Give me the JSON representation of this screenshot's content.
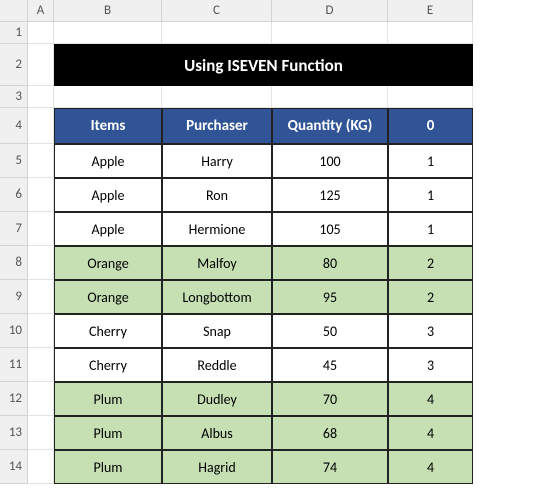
{
  "columns": [
    "A",
    "B",
    "C",
    "D",
    "E"
  ],
  "rows": [
    "1",
    "2",
    "3",
    "4",
    "5",
    "6",
    "7",
    "8",
    "9",
    "10",
    "11",
    "12",
    "13",
    "14"
  ],
  "title": "Using ISEVEN Function",
  "headers": {
    "items": "Items",
    "purchaser": "Purchaser",
    "quantity": "Quantity (KG)",
    "group": "0"
  },
  "data": [
    {
      "item": "Apple",
      "purchaser": "Harry",
      "qty": "100",
      "grp": "1",
      "alt": false
    },
    {
      "item": "Apple",
      "purchaser": "Ron",
      "qty": "125",
      "grp": "1",
      "alt": false
    },
    {
      "item": "Apple",
      "purchaser": "Hermione",
      "qty": "105",
      "grp": "1",
      "alt": false
    },
    {
      "item": "Orange",
      "purchaser": "Malfoy",
      "qty": "80",
      "grp": "2",
      "alt": true
    },
    {
      "item": "Orange",
      "purchaser": "Longbottom",
      "qty": "95",
      "grp": "2",
      "alt": true
    },
    {
      "item": "Cherry",
      "purchaser": "Snap",
      "qty": "50",
      "grp": "3",
      "alt": false
    },
    {
      "item": "Cherry",
      "purchaser": "Reddle",
      "qty": "45",
      "grp": "3",
      "alt": false
    },
    {
      "item": "Plum",
      "purchaser": "Dudley",
      "qty": "70",
      "grp": "4",
      "alt": true
    },
    {
      "item": "Plum",
      "purchaser": "Albus",
      "qty": "68",
      "grp": "4",
      "alt": true
    },
    {
      "item": "Plum",
      "purchaser": "Hagrid",
      "qty": "74",
      "grp": "4",
      "alt": true
    }
  ],
  "chart_data": {
    "type": "table",
    "title": "Using ISEVEN Function",
    "columns": [
      "Items",
      "Purchaser",
      "Quantity (KG)",
      "0"
    ],
    "rows": [
      [
        "Apple",
        "Harry",
        100,
        1
      ],
      [
        "Apple",
        "Ron",
        125,
        1
      ],
      [
        "Apple",
        "Hermione",
        105,
        1
      ],
      [
        "Orange",
        "Malfoy",
        80,
        2
      ],
      [
        "Orange",
        "Longbottom",
        95,
        2
      ],
      [
        "Cherry",
        "Snap",
        50,
        3
      ],
      [
        "Cherry",
        "Reddle",
        45,
        3
      ],
      [
        "Plum",
        "Dudley",
        70,
        4
      ],
      [
        "Plum",
        "Albus",
        68,
        4
      ],
      [
        "Plum",
        "Hagrid",
        74,
        4
      ]
    ]
  }
}
